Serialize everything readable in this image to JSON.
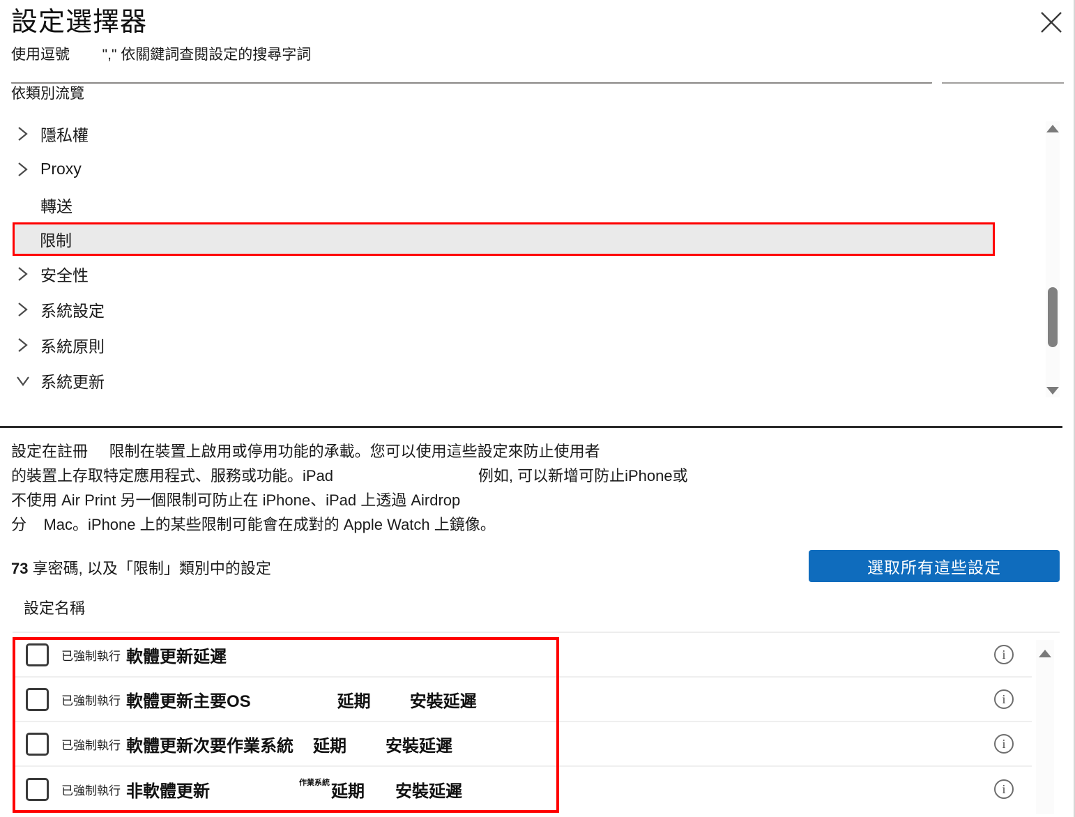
{
  "dialog": {
    "title": "設定選擇器",
    "subtitle": "使用逗號        \",\" 依關鍵詞查閱設定的搜尋字詞",
    "close_label": "×"
  },
  "browse": {
    "label": "依類別流覽"
  },
  "tree": {
    "items": [
      {
        "label": "隱私權",
        "expandable": true,
        "expanded": false,
        "selected": false
      },
      {
        "label": "Proxy  ",
        "expandable": true,
        "expanded": false,
        "selected": false
      },
      {
        "label": "轉送",
        "expandable": false,
        "expanded": false,
        "selected": false
      },
      {
        "label": "限制",
        "expandable": false,
        "expanded": false,
        "selected": true
      },
      {
        "label": "安全性",
        "expandable": true,
        "expanded": false,
        "selected": false
      },
      {
        "label": "系統設定",
        "expandable": true,
        "expanded": false,
        "selected": false
      },
      {
        "label": "系統原則",
        "expandable": true,
        "expanded": false,
        "selected": false
      },
      {
        "label": "系統更新",
        "expandable": true,
        "expanded": true,
        "selected": false
      }
    ]
  },
  "description": {
    "lines": [
      "設定在註冊     限制在裝置上啟用或停用功能的承載。您可以使用這些設定來防止使用者",
      "的裝置上存取特定應用程式、服務或功能。iPad                                  例如, 可以新增可防止iPhone或",
      "不使用 Air Print 另一個限制可防止在 iPhone、iPad 上透過 Airdrop",
      "分    Mac。iPhone 上的某些限制可能會在成對的 Apple Watch 上鏡像。"
    ]
  },
  "count": {
    "number": "73",
    "text": " 享密碼, 以及「限制」類別中的設定"
  },
  "actions": {
    "select_all_label": "選取所有這些設定"
  },
  "table": {
    "column_header": "設定名稱",
    "rows": [
      {
        "enforced_label": "已強制執行",
        "name": "軟體更新延遲",
        "tiny": "",
        "frag1": "",
        "frag2": "",
        "info": "i"
      },
      {
        "enforced_label": "已強制執行",
        "name": "軟體更新主要OS",
        "tiny": "",
        "frag1": "延期",
        "frag2": "安裝延遲",
        "info": "i"
      },
      {
        "enforced_label": "已強制執行",
        "name": "軟體更新次要作業系統",
        "tiny": "",
        "frag1": "延期",
        "frag2": "安裝延遲",
        "info": "i"
      },
      {
        "enforced_label": "已強制執行",
        "name": "非軟體更新",
        "tiny": "作業系統",
        "frag1": "延期",
        "frag2": "安裝延遲",
        "info": "i"
      }
    ]
  },
  "colors": {
    "accent": "#0f6cbd",
    "highlight_outline": "#ff0000",
    "selected_row_bg": "#eaeaea"
  }
}
